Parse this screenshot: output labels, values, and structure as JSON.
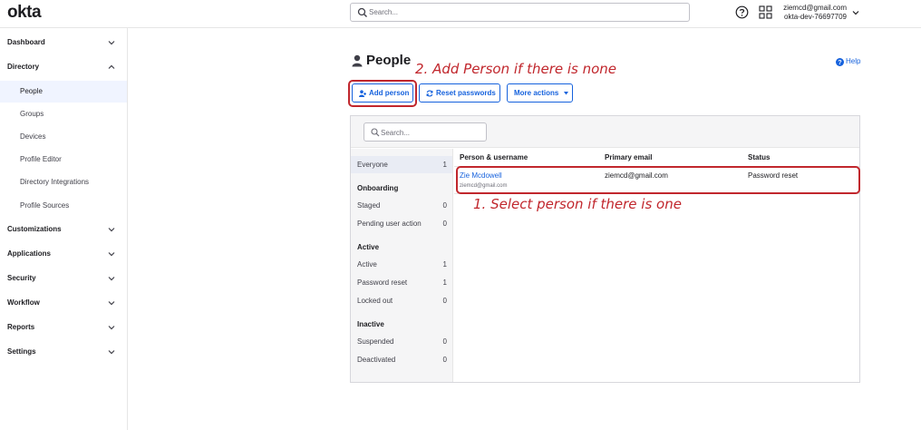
{
  "brand": {
    "logo": "okta",
    "accent": "#1662dd",
    "annotation_color": "#c1272d"
  },
  "topbar": {
    "search_placeholder": "Search...",
    "user_email": "ziemcd@gmail.com",
    "org_name": "okta-dev-76697709",
    "icons": [
      "search-icon",
      "help-icon",
      "app-grid-icon",
      "chevron-down-icon"
    ]
  },
  "sidebar": {
    "sections": [
      {
        "label": "Dashboard",
        "expanded": false
      },
      {
        "label": "Directory",
        "expanded": true,
        "items": [
          "People",
          "Groups",
          "Devices",
          "Profile Editor",
          "Directory Integrations",
          "Profile Sources"
        ],
        "active_item": "People"
      },
      {
        "label": "Customizations",
        "expanded": false
      },
      {
        "label": "Applications",
        "expanded": false
      },
      {
        "label": "Security",
        "expanded": false
      },
      {
        "label": "Workflow",
        "expanded": false
      },
      {
        "label": "Reports",
        "expanded": false
      },
      {
        "label": "Settings",
        "expanded": false
      }
    ]
  },
  "page": {
    "title": "People",
    "help_label": "Help",
    "buttons": {
      "add_person": "Add person",
      "reset_passwords": "Reset passwords",
      "more_actions": "More actions"
    }
  },
  "annotations": {
    "add_person_hint": "2. Add Person if there is none",
    "select_person_hint": "1. Select person if there is one"
  },
  "panel": {
    "search_placeholder": "Search...",
    "filters": {
      "everyone": {
        "label": "Everyone",
        "count": "1"
      },
      "groups": [
        {
          "heading": "Onboarding",
          "items": [
            {
              "label": "Staged",
              "count": "0"
            },
            {
              "label": "Pending user action",
              "count": "0"
            }
          ]
        },
        {
          "heading": "Active",
          "items": [
            {
              "label": "Active",
              "count": "1"
            },
            {
              "label": "Password reset",
              "count": "1"
            },
            {
              "label": "Locked out",
              "count": "0"
            }
          ]
        },
        {
          "heading": "Inactive",
          "items": [
            {
              "label": "Suspended",
              "count": "0"
            },
            {
              "label": "Deactivated",
              "count": "0"
            }
          ]
        }
      ]
    },
    "table": {
      "columns": [
        "Person & username",
        "Primary email",
        "Status"
      ],
      "rows": [
        {
          "name": "Zie Mcdowell",
          "username": "ziemcd@gmail.com",
          "email": "ziemcd@gmail.com",
          "status": "Password reset"
        }
      ]
    }
  }
}
